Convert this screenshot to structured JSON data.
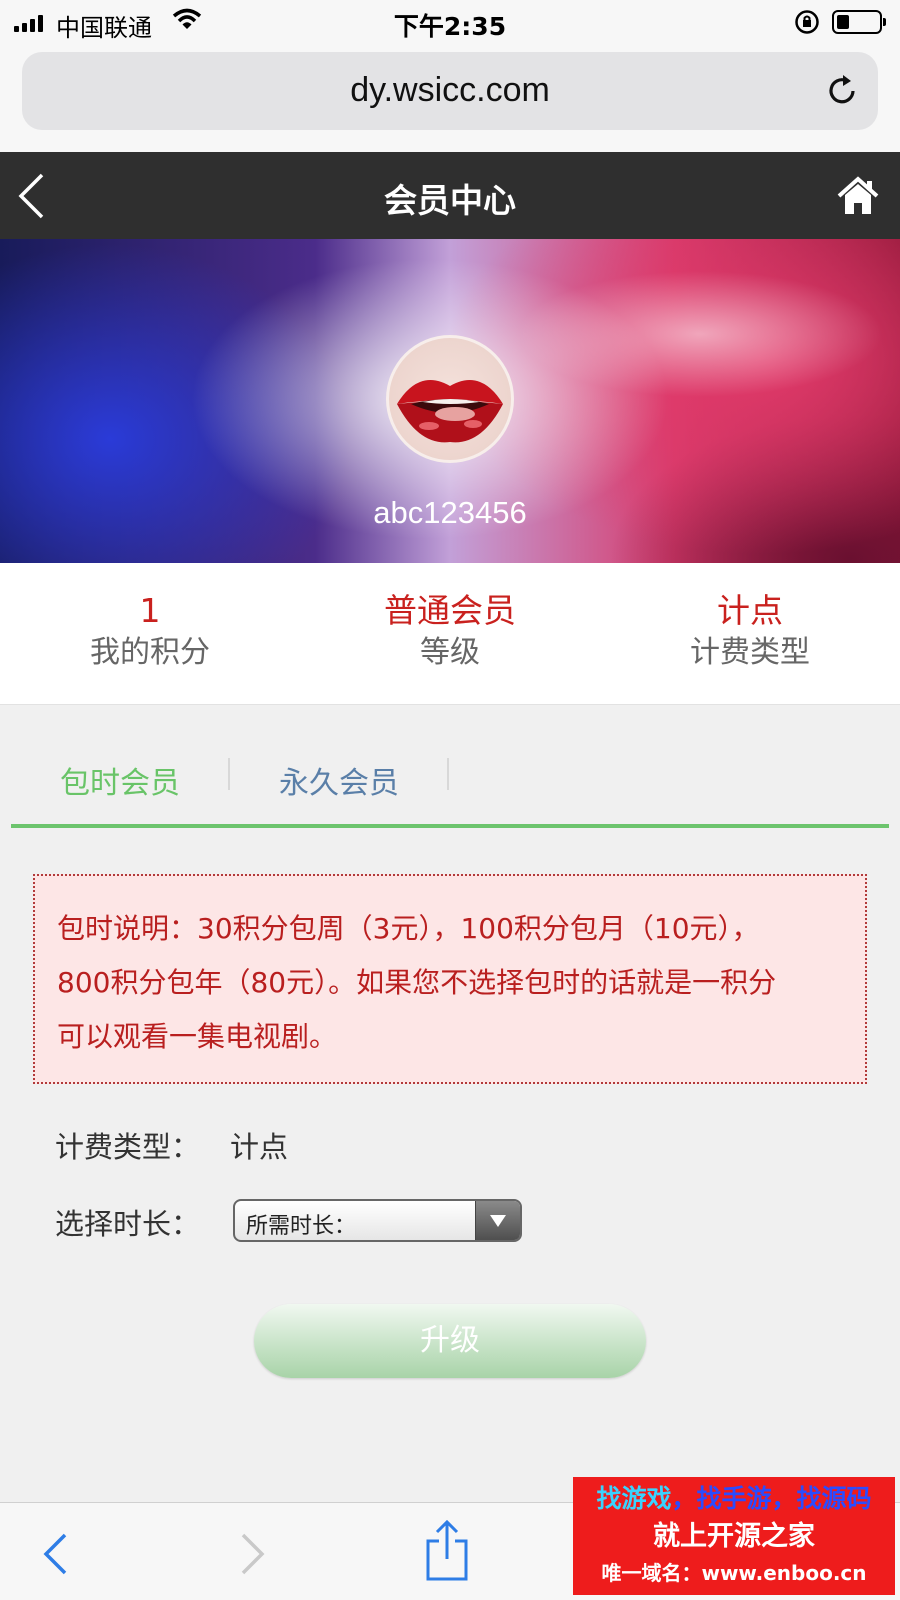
{
  "status_bar": {
    "carrier": "中国联通",
    "time": "下午2:35"
  },
  "browser": {
    "url": "dy.wsicc.com"
  },
  "header": {
    "title": "会员中心"
  },
  "profile": {
    "username": "abc123456"
  },
  "stats": [
    {
      "value": "1",
      "label": "我的积分"
    },
    {
      "value": "普通会员",
      "label": "等级"
    },
    {
      "value": "计点",
      "label": "计费类型"
    }
  ],
  "tabs": [
    {
      "label": "包时会员",
      "active": true
    },
    {
      "label": "永久会员",
      "active": false
    }
  ],
  "notice": {
    "line1": "包时说明：30积分包周（3元），100积分包月（10元），",
    "line2": "800积分包年（80元）。如果您不选择包时的话就是一积分",
    "line3": "可以观看一集电视剧。"
  },
  "form": {
    "billing_label": "计费类型：",
    "billing_value": "计点",
    "duration_label": "选择时长：",
    "duration_select": "所需时长："
  },
  "upgrade_button": "升级",
  "watermark": {
    "part1": "找游戏",
    "part2": "，找手游，找源码",
    "line2": "就上开源之家",
    "line3": "唯一域名：www.enboo.cn"
  },
  "colors": {
    "accent_green": "#6cc46d",
    "value_red": "#c9211e",
    "header_bg": "#2f2f2f"
  }
}
